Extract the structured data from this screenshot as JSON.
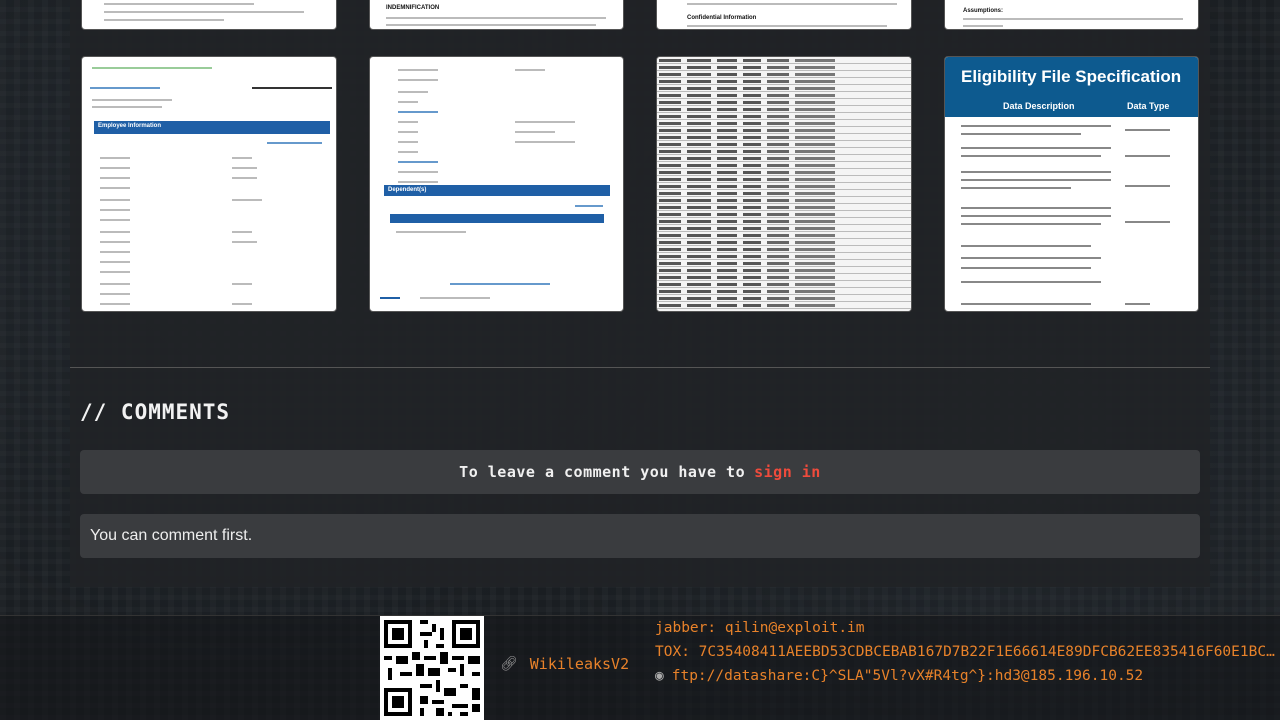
{
  "comments": {
    "title": "// COMMENTS",
    "signin_prompt": "To leave a comment you have to",
    "signin_link": "sign in",
    "empty_text": "You can comment first."
  },
  "footer": {
    "link_label": "WikileaksV2",
    "jabber": "jabber: qilin@exploit.im",
    "tox": "TOX: 7C35408411AEEBD53CDBCEBAB167D7B22F1E66614E89DFCB62EE835416F60E1BC…",
    "ftp": "ftp://datashare:C}^SLA\"5Vl?vX#R4tg^}:hd3@185.196.10.52"
  },
  "thumbnails": {
    "doc1_heading": "INDEMNIFICATION",
    "doc3_heading": "Confidential Information",
    "doc4_heading": "Assumptions:",
    "employee_header": "Employee Information",
    "dependents_header": "Dependent(s)",
    "spec_title": "Eligibility File Specification",
    "spec_col1": "Data Description",
    "spec_col2": "Data Type"
  },
  "colors": {
    "accent_orange": "#e8822a",
    "signin_red": "#ef4b3c",
    "doc_blue": "#1f5fa6"
  }
}
